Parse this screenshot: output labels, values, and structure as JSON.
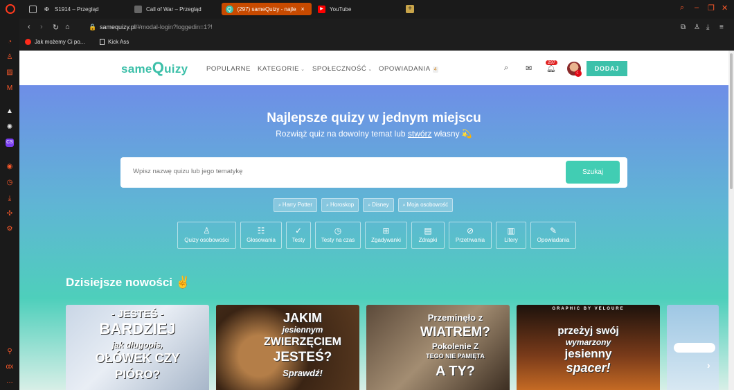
{
  "browser": {
    "tabs": [
      {
        "title": "S1914 – Przegląd",
        "active": false
      },
      {
        "title": "Call of War – Przegląd",
        "active": false
      },
      {
        "title": "(297) sameQuizy - najlep",
        "active": true
      },
      {
        "title": "YouTube",
        "active": false
      }
    ],
    "url_host": "samequizy.pl",
    "url_path": "/#modal-login?loggedin=1?!",
    "bookmarks": [
      "Jak możemy Ci po...",
      "Kick Ass"
    ]
  },
  "header": {
    "logo_prefix": "same",
    "logo_q": "Q",
    "logo_suffix": "uizy",
    "nav": {
      "popular": "POPULARNE",
      "categories": "KATEGORIE",
      "community": "SPOŁECZNOŚĆ",
      "stories": "OPOWIADANIA",
      "stories_count": "4"
    },
    "notifications": "297",
    "add_button": "DODAJ"
  },
  "hero": {
    "title": "Najlepsze quizy w jednym miejscu",
    "subtitle_before": "Rozwiąż quiz na dowolny temat lub ",
    "subtitle_link": "stwórz",
    "subtitle_after": " własny 💫",
    "search_placeholder": "Wpisz nazwę quizu lub jego tematykę",
    "search_button": "Szukaj",
    "tags": [
      "Harry Potter",
      "Horoskop",
      "Disney",
      "Moja osobowość"
    ],
    "categories": [
      "Quizy osobowości",
      "Głosowania",
      "Testy",
      "Testy na czas",
      "Zgadywanki",
      "Zdrapki",
      "Przetrwania",
      "Litery",
      "Opowiadania"
    ]
  },
  "section": {
    "title": "Dzisiejsze nowości ✌️"
  },
  "cards": [
    {
      "lines": [
        "- JESTEŚ -",
        "BARDZIEJ",
        "jak długopis,",
        "OŁÓWEK CZY",
        "PIÓRO?"
      ]
    },
    {
      "lines": [
        "JAKIM",
        "jesiennym",
        "ZWIERZĘCIEM",
        "JESTEŚ?",
        "Sprawdź!"
      ]
    },
    {
      "lines": [
        "Przeminęło z",
        "WIATREM?",
        "Pokolenie Z",
        "TEGO NIE PAMIĘTA",
        "A TY?"
      ]
    },
    {
      "lines": [
        "GRAPHIC BY VELOURE",
        "przeżyj swój",
        "wymarzony",
        "jesienny",
        "spacer!"
      ]
    }
  ]
}
